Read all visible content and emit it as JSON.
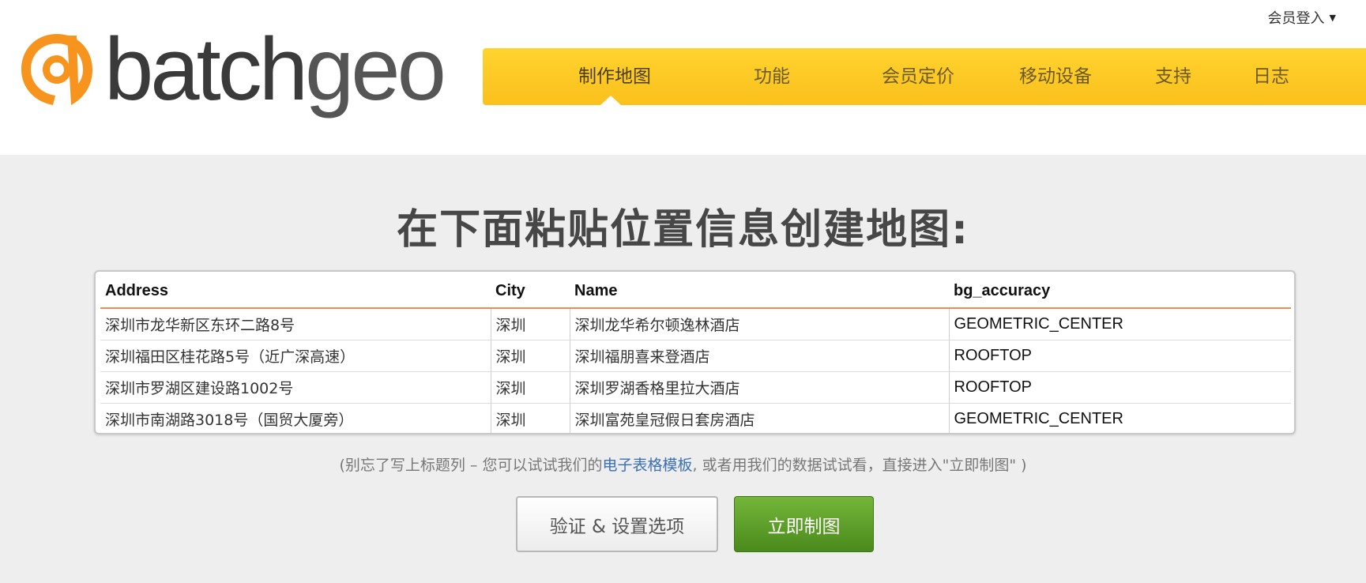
{
  "header": {
    "login_label": "会员登入",
    "login_caret": "▼",
    "logo": {
      "text_batch": "batch",
      "text_geo": "geo",
      "icon": "batchgeo-logo-icon",
      "orange": "#f7941e"
    },
    "nav": [
      {
        "label": "制作地图",
        "active": true
      },
      {
        "label": "功能"
      },
      {
        "label": "会员定价"
      },
      {
        "label": "移动设备"
      },
      {
        "label": "支持"
      },
      {
        "label": "日志"
      }
    ],
    "nav_color": "#fcc824"
  },
  "main": {
    "headline": "在下面粘贴位置信息创建地图:",
    "table": {
      "columns": [
        "Address",
        "City",
        "Name",
        "bg_accuracy"
      ],
      "rows": [
        [
          "深圳市龙华新区东环二路8号",
          "深圳",
          "深圳龙华希尔顿逸林酒店",
          "GEOMETRIC_CENTER"
        ],
        [
          "深圳福田区桂花路5号（近广深高速）",
          "深圳",
          "深圳福朋喜来登酒店",
          "ROOFTOP"
        ],
        [
          "深圳市罗湖区建设路1002号",
          "深圳",
          "深圳罗湖香格里拉大酒店",
          "ROOFTOP"
        ],
        [
          "深圳市南湖路3018号（国贸大厦旁）",
          "深圳",
          "深圳富苑皇冠假日套房酒店",
          "GEOMETRIC_CENTER"
        ]
      ]
    },
    "hint": {
      "before": "(别忘了写上标题列 – 您可以试试我们的",
      "link": "电子表格模板",
      "after": ", 或者用我们的数据试试看，直接进入\"立即制图\" )"
    },
    "buttons": {
      "validate": "验证 & 设置选项",
      "make_map": "立即制图"
    },
    "colors": {
      "make_map_green": "#5a9e2a",
      "header_rule": "#f08a5a",
      "link": "#3b6fb6"
    }
  }
}
